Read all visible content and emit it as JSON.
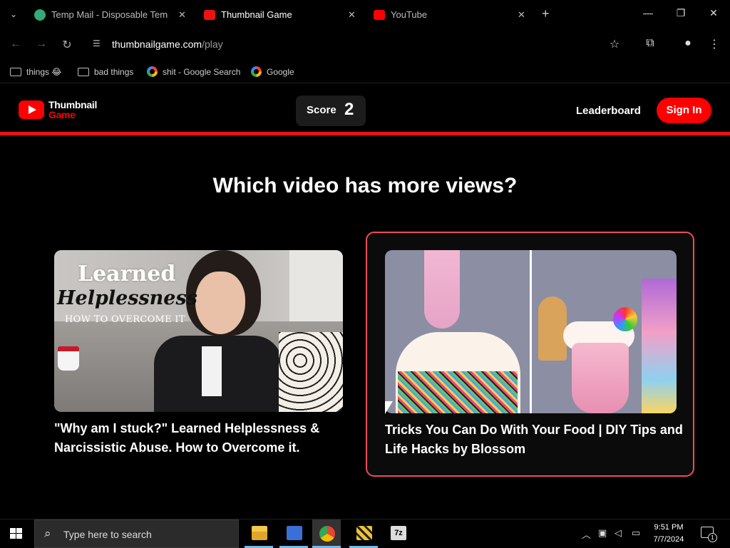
{
  "browser": {
    "tabs": [
      {
        "title": "Temp Mail - Disposable Tempo",
        "active": false,
        "icon": "tempmail-icon"
      },
      {
        "title": "Thumbnail Game",
        "active": true,
        "icon": "tg-icon"
      },
      {
        "title": "YouTube",
        "active": false,
        "icon": "youtube-icon"
      }
    ],
    "address": {
      "host": "thumbnailgame.com",
      "path": "/play"
    },
    "bookmarks": [
      {
        "label": "things 😂",
        "icon": "folder-icon"
      },
      {
        "label": "bad things",
        "icon": "folder-icon"
      },
      {
        "label": "shit - Google Search",
        "icon": "google-icon"
      },
      {
        "label": "Google",
        "icon": "google-icon"
      }
    ]
  },
  "site": {
    "logo_line1": "Thumbnail",
    "logo_line2": "Game",
    "score_label": "Score",
    "score_value": "2",
    "leaderboard": "Leaderboard",
    "sign_in": "Sign In",
    "accent": "#ff0000"
  },
  "game": {
    "question": "Which video has more views?",
    "videos": [
      {
        "title": "\"Why am I stuck?\" Learned Helplessness & Narcissistic Abuse. How to Overcome it.",
        "thumb_text": [
          "Learned",
          "Helplessness",
          "HOW TO OVERCOME IT"
        ],
        "selected": false
      },
      {
        "title": "Tricks You Can Do With Your Food | DIY Tips and Life Hacks by Blossom",
        "selected": true
      }
    ]
  },
  "taskbar": {
    "search_placeholder": "Type here to search",
    "time": "9:51 PM",
    "date": "7/7/2024",
    "notification_count": "1"
  }
}
